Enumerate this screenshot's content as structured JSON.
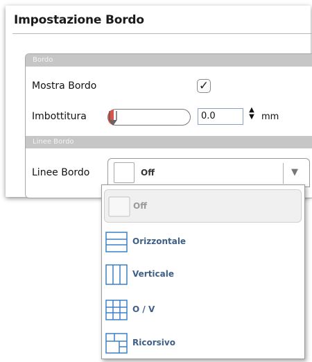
{
  "panel": {
    "title": "Impostazione Bordo"
  },
  "sections": {
    "bordo": "Bordo",
    "linee_bordo": "Linee Bordo"
  },
  "rows": {
    "mostra_bordo": {
      "label": "Mostra Bordo",
      "checked": true,
      "check_glyph": "✓"
    },
    "imbottitura": {
      "label": "Imbottitura",
      "value": "0.0",
      "unit": "mm",
      "slider_fraction": 0.0
    },
    "linee_bordo": {
      "label": "Linee Bordo",
      "selected": "Off",
      "arrow_glyph": "▼"
    }
  },
  "dropdown": {
    "options": [
      {
        "label": "Off",
        "icon": "border-none-icon",
        "selected": true
      },
      {
        "label": "Orizzontale",
        "icon": "border-horizontal-icon",
        "selected": false
      },
      {
        "label": "Verticale",
        "icon": "border-vertical-icon",
        "selected": false
      },
      {
        "label": "O / V",
        "icon": "border-grid-icon",
        "selected": false
      },
      {
        "label": "Ricorsivo",
        "icon": "border-recursive-icon",
        "selected": false
      }
    ]
  },
  "icons": {
    "spinner_up": "▲",
    "spinner_down": "▼"
  },
  "colors": {
    "section_header": "#c6c6c6",
    "slider_fill": "#d9534f",
    "icon_blue": "#3b7ec8",
    "option_text": "#3f5f88"
  }
}
